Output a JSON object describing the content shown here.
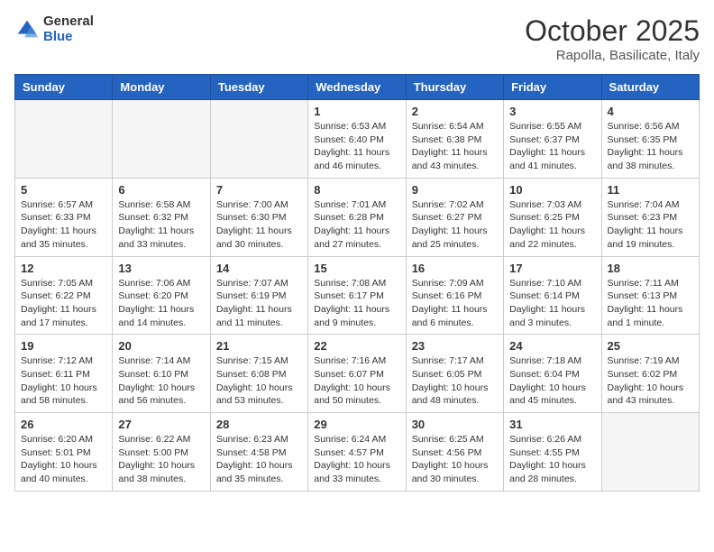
{
  "logo": {
    "general": "General",
    "blue": "Blue"
  },
  "title": "October 2025",
  "subtitle": "Rapolla, Basilicate, Italy",
  "weekdays": [
    "Sunday",
    "Monday",
    "Tuesday",
    "Wednesday",
    "Thursday",
    "Friday",
    "Saturday"
  ],
  "weeks": [
    [
      {
        "day": "",
        "info": ""
      },
      {
        "day": "",
        "info": ""
      },
      {
        "day": "",
        "info": ""
      },
      {
        "day": "1",
        "info": "Sunrise: 6:53 AM\nSunset: 6:40 PM\nDaylight: 11 hours\nand 46 minutes."
      },
      {
        "day": "2",
        "info": "Sunrise: 6:54 AM\nSunset: 6:38 PM\nDaylight: 11 hours\nand 43 minutes."
      },
      {
        "day": "3",
        "info": "Sunrise: 6:55 AM\nSunset: 6:37 PM\nDaylight: 11 hours\nand 41 minutes."
      },
      {
        "day": "4",
        "info": "Sunrise: 6:56 AM\nSunset: 6:35 PM\nDaylight: 11 hours\nand 38 minutes."
      }
    ],
    [
      {
        "day": "5",
        "info": "Sunrise: 6:57 AM\nSunset: 6:33 PM\nDaylight: 11 hours\nand 35 minutes."
      },
      {
        "day": "6",
        "info": "Sunrise: 6:58 AM\nSunset: 6:32 PM\nDaylight: 11 hours\nand 33 minutes."
      },
      {
        "day": "7",
        "info": "Sunrise: 7:00 AM\nSunset: 6:30 PM\nDaylight: 11 hours\nand 30 minutes."
      },
      {
        "day": "8",
        "info": "Sunrise: 7:01 AM\nSunset: 6:28 PM\nDaylight: 11 hours\nand 27 minutes."
      },
      {
        "day": "9",
        "info": "Sunrise: 7:02 AM\nSunset: 6:27 PM\nDaylight: 11 hours\nand 25 minutes."
      },
      {
        "day": "10",
        "info": "Sunrise: 7:03 AM\nSunset: 6:25 PM\nDaylight: 11 hours\nand 22 minutes."
      },
      {
        "day": "11",
        "info": "Sunrise: 7:04 AM\nSunset: 6:23 PM\nDaylight: 11 hours\nand 19 minutes."
      }
    ],
    [
      {
        "day": "12",
        "info": "Sunrise: 7:05 AM\nSunset: 6:22 PM\nDaylight: 11 hours\nand 17 minutes."
      },
      {
        "day": "13",
        "info": "Sunrise: 7:06 AM\nSunset: 6:20 PM\nDaylight: 11 hours\nand 14 minutes."
      },
      {
        "day": "14",
        "info": "Sunrise: 7:07 AM\nSunset: 6:19 PM\nDaylight: 11 hours\nand 11 minutes."
      },
      {
        "day": "15",
        "info": "Sunrise: 7:08 AM\nSunset: 6:17 PM\nDaylight: 11 hours\nand 9 minutes."
      },
      {
        "day": "16",
        "info": "Sunrise: 7:09 AM\nSunset: 6:16 PM\nDaylight: 11 hours\nand 6 minutes."
      },
      {
        "day": "17",
        "info": "Sunrise: 7:10 AM\nSunset: 6:14 PM\nDaylight: 11 hours\nand 3 minutes."
      },
      {
        "day": "18",
        "info": "Sunrise: 7:11 AM\nSunset: 6:13 PM\nDaylight: 11 hours\nand 1 minute."
      }
    ],
    [
      {
        "day": "19",
        "info": "Sunrise: 7:12 AM\nSunset: 6:11 PM\nDaylight: 10 hours\nand 58 minutes."
      },
      {
        "day": "20",
        "info": "Sunrise: 7:14 AM\nSunset: 6:10 PM\nDaylight: 10 hours\nand 56 minutes."
      },
      {
        "day": "21",
        "info": "Sunrise: 7:15 AM\nSunset: 6:08 PM\nDaylight: 10 hours\nand 53 minutes."
      },
      {
        "day": "22",
        "info": "Sunrise: 7:16 AM\nSunset: 6:07 PM\nDaylight: 10 hours\nand 50 minutes."
      },
      {
        "day": "23",
        "info": "Sunrise: 7:17 AM\nSunset: 6:05 PM\nDaylight: 10 hours\nand 48 minutes."
      },
      {
        "day": "24",
        "info": "Sunrise: 7:18 AM\nSunset: 6:04 PM\nDaylight: 10 hours\nand 45 minutes."
      },
      {
        "day": "25",
        "info": "Sunrise: 7:19 AM\nSunset: 6:02 PM\nDaylight: 10 hours\nand 43 minutes."
      }
    ],
    [
      {
        "day": "26",
        "info": "Sunrise: 6:20 AM\nSunset: 5:01 PM\nDaylight: 10 hours\nand 40 minutes."
      },
      {
        "day": "27",
        "info": "Sunrise: 6:22 AM\nSunset: 5:00 PM\nDaylight: 10 hours\nand 38 minutes."
      },
      {
        "day": "28",
        "info": "Sunrise: 6:23 AM\nSunset: 4:58 PM\nDaylight: 10 hours\nand 35 minutes."
      },
      {
        "day": "29",
        "info": "Sunrise: 6:24 AM\nSunset: 4:57 PM\nDaylight: 10 hours\nand 33 minutes."
      },
      {
        "day": "30",
        "info": "Sunrise: 6:25 AM\nSunset: 4:56 PM\nDaylight: 10 hours\nand 30 minutes."
      },
      {
        "day": "31",
        "info": "Sunrise: 6:26 AM\nSunset: 4:55 PM\nDaylight: 10 hours\nand 28 minutes."
      },
      {
        "day": "",
        "info": ""
      }
    ]
  ]
}
